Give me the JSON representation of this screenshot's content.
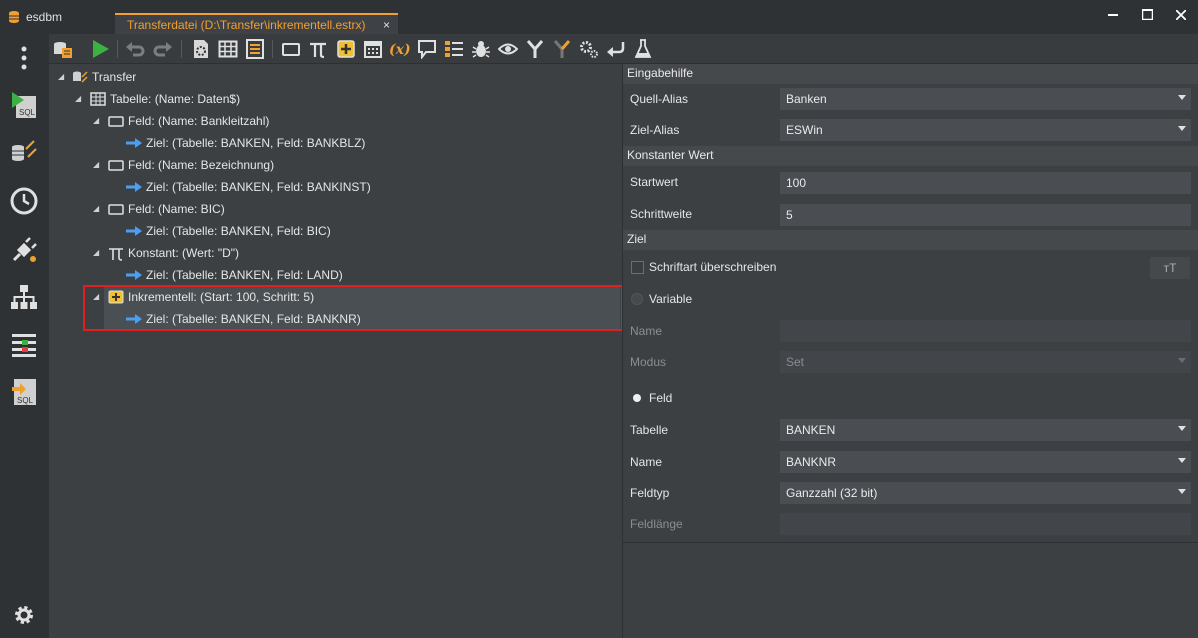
{
  "app": {
    "name": "esdbm"
  },
  "document_tab": {
    "title": "Transferdatei (D:\\Transfer\\inkrementell.estrx)",
    "close": "×"
  },
  "window_controls": {
    "minimize": "▬",
    "maximize": "☐",
    "close": "✕"
  },
  "sidebar": {
    "items": [
      {
        "name": "menu",
        "icon": "more-vert-icon"
      },
      {
        "name": "sql-editor",
        "icon": "sql-play-icon"
      },
      {
        "name": "db-transfer",
        "icon": "db-transfer-icon"
      },
      {
        "name": "history",
        "icon": "clock-icon"
      },
      {
        "name": "connect",
        "icon": "plug-icon"
      },
      {
        "name": "hierarchy",
        "icon": "hierarchy-icon"
      },
      {
        "name": "compare",
        "icon": "compare-icon"
      },
      {
        "name": "sql-import",
        "icon": "sql-import-icon"
      },
      {
        "name": "settings",
        "icon": "gear-icon"
      }
    ]
  },
  "toolbar": {
    "buttons": [
      "database-list-icon",
      "run-icon",
      "undo-icon",
      "redo-icon",
      "file-settings-icon",
      "table-icon",
      "list-icon",
      "field-icon",
      "pi-constant-icon",
      "increment-icon",
      "calendar-icon",
      "variable-icon",
      "comment-icon",
      "list-edit-icon",
      "bug-icon",
      "eye-icon",
      "merge-icon",
      "split-icon",
      "gears-icon",
      "return-icon",
      "flask-icon"
    ]
  },
  "tree": {
    "root": "Transfer",
    "table": "Tabelle: (Name: Daten$)",
    "items": [
      {
        "label": "Feld: (Name: Bankleitzahl)",
        "target": "Ziel: (Tabelle: BANKEN, Feld: BANKBLZ)"
      },
      {
        "label": "Feld: (Name: Bezeichnung)",
        "target": "Ziel: (Tabelle: BANKEN, Feld: BANKINST)"
      },
      {
        "label": "Feld: (Name: BIC)",
        "target": "Ziel: (Tabelle: BANKEN, Feld: BIC)"
      },
      {
        "label": "Konstant: (Wert: \"D\")",
        "target": "Ziel: (Tabelle: BANKEN, Feld: LAND)"
      },
      {
        "label": "Inkrementell: (Start: 100, Schritt: 5)",
        "target": "Ziel: (Tabelle: BANKEN, Feld: BANKNR)"
      }
    ]
  },
  "properties": {
    "cat_eingabehilfe": "Eingabehilfe",
    "quell_alias_label": "Quell-Alias",
    "quell_alias_value": "Banken",
    "ziel_alias_label": "Ziel-Alias",
    "ziel_alias_value": "ESWin",
    "cat_konstanter_wert": "Konstanter Wert",
    "startwert_label": "Startwert",
    "startwert_value": "100",
    "schrittweite_label": "Schrittweite",
    "schrittweite_value": "5",
    "cat_ziel": "Ziel",
    "schriftart_label": "Schriftart überschreiben",
    "font_button": "ᴛT",
    "variable_label": "Variable",
    "name_var_label": "Name",
    "name_var_value": "",
    "modus_label": "Modus",
    "modus_value": "Set",
    "feld_label": "Feld",
    "tabelle_label": "Tabelle",
    "tabelle_value": "BANKEN",
    "name_label": "Name",
    "name_value": "BANKNR",
    "feldtyp_label": "Feldtyp",
    "feldtyp_value": "Ganzzahl (32 bit)",
    "feldlaenge_label": "Feldlänge",
    "feldlaenge_value": ""
  }
}
